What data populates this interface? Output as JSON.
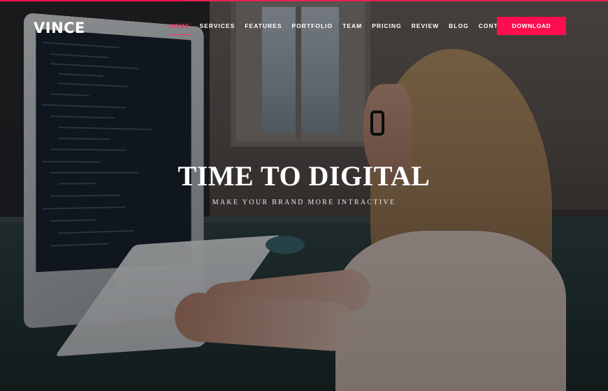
{
  "brand": {
    "logo_text": "VINCE",
    "accent": "#ff0d4d"
  },
  "nav": {
    "items": [
      {
        "label": "HOME",
        "active": true
      },
      {
        "label": "SERVICES",
        "active": false
      },
      {
        "label": "FEATURES",
        "active": false
      },
      {
        "label": "PORTFOLIO",
        "active": false
      },
      {
        "label": "TEAM",
        "active": false
      },
      {
        "label": "PRICING",
        "active": false
      },
      {
        "label": "REVIEW",
        "active": false
      },
      {
        "label": "BLOG",
        "active": false
      },
      {
        "label": "CONTACT",
        "active": false
      }
    ],
    "cta_label": "DOWNLOAD"
  },
  "hero": {
    "title": "TIME TO DIGITAL",
    "subtitle": "MAKE YOUR BRAND MORE INTRACTIVE",
    "background_image": "woman-working-at-computer"
  }
}
